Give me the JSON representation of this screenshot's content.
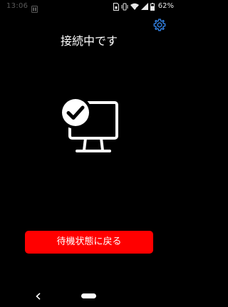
{
  "status_bar": {
    "time": "13:06",
    "battery_percent": "62%",
    "icons": [
      "notification-icon",
      "sim-icon",
      "vibrate-icon",
      "wifi-icon",
      "cellular-signal-icon",
      "battery-icon"
    ]
  },
  "header": {
    "title": "接続中です",
    "settings_icon": "gear-icon"
  },
  "status_illustration": {
    "icon": "monitor-check-icon",
    "state": "connected"
  },
  "actions": {
    "return_label": "待機状態に戻る"
  },
  "nav_bar": {
    "back_icon": "back-chevron-icon",
    "home_icon": "home-pill-icon"
  },
  "colors": {
    "background": "#000000",
    "accent": "#2f7bd9",
    "primary_button": "#ff0000",
    "text": "#ffffff"
  }
}
